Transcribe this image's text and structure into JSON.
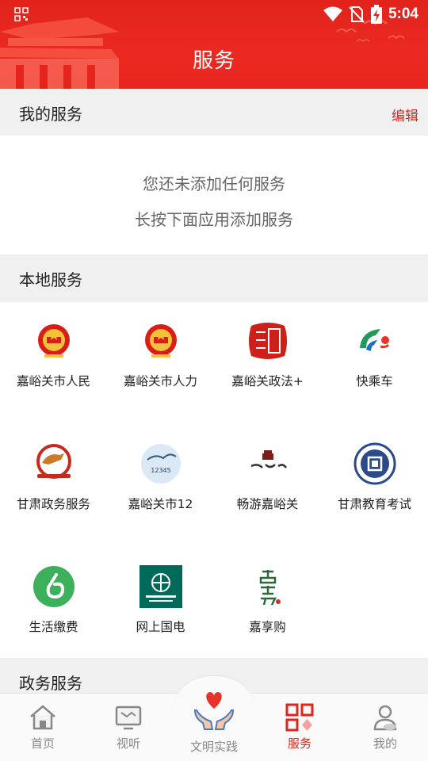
{
  "status_bar": {
    "time": "5:04",
    "icons": [
      "qr-scan-icon",
      "wifi-icon",
      "no-sim-icon",
      "battery-charging-icon"
    ]
  },
  "header": {
    "title": "服务",
    "background_color": "#e2231c"
  },
  "my_services": {
    "title": "我的服务",
    "edit_label": "编辑",
    "empty_line1": "您还未添加任何服务",
    "empty_line2": "长按下面应用添加服务"
  },
  "local_services": {
    "title": "本地服务",
    "apps": [
      {
        "label": "嘉峪关市人民",
        "icon": "national-emblem-icon"
      },
      {
        "label": "嘉峪关市人力",
        "icon": "national-emblem-icon"
      },
      {
        "label": "嘉峪关政法+",
        "icon": "politics-law-seal-icon"
      },
      {
        "label": "快乘车",
        "icon": "quick-ride-logo-icon"
      },
      {
        "label": "甘肃政务服务",
        "icon": "gansu-gov-service-logo-icon"
      },
      {
        "label": "嘉峪关市12",
        "icon": "hotline-12345-logo-icon"
      },
      {
        "label": "畅游嘉峪关",
        "icon": "travel-jiayuguan-logo-icon"
      },
      {
        "label": "甘肃教育考试",
        "icon": "gansu-education-exam-logo-icon"
      },
      {
        "label": "生活缴费",
        "icon": "bill-payment-icon"
      },
      {
        "label": "网上国电",
        "icon": "state-grid-logo-icon"
      },
      {
        "label": "嘉享购",
        "icon": "jiaxianggou-logo-icon"
      }
    ]
  },
  "gov_services": {
    "title": "政务服务"
  },
  "tabbar": {
    "active_color": "#e0251d",
    "tabs": [
      {
        "label": "首页",
        "icon": "home-icon"
      },
      {
        "label": "视听",
        "icon": "tv-icon"
      },
      {
        "label": "文明实践",
        "icon": "hands-heart-icon"
      },
      {
        "label": "服务",
        "icon": "services-grid-icon"
      },
      {
        "label": "我的",
        "icon": "user-icon"
      }
    ]
  }
}
